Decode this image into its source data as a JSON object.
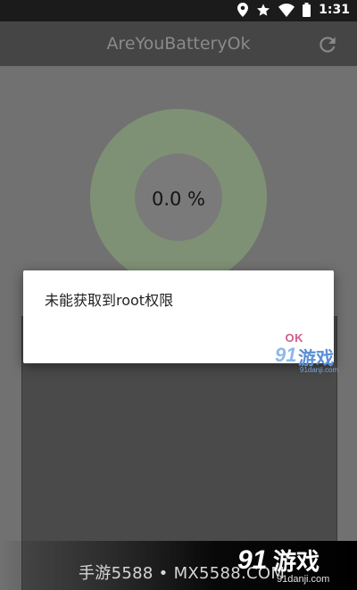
{
  "status_bar": {
    "time": "1:31",
    "icons": [
      "location-icon",
      "star-icon",
      "wifi-icon",
      "battery-icon"
    ]
  },
  "toolbar": {
    "title": "AreYouBatteryOk",
    "refresh_icon": "refresh-icon"
  },
  "battery": {
    "percent_text": "0.0 %",
    "ring_color": "#7f9175"
  },
  "dialog": {
    "message": "未能获取到root权限",
    "ok_label": "OK",
    "accent": "#cf5f8a"
  },
  "watermark_small": {
    "logo": "91",
    "text": "游戏",
    "url": "91danji.com"
  },
  "footer": {
    "text": "手游5588 • MX5588.COM"
  },
  "watermark_big": {
    "logo": "91",
    "text": "游戏",
    "url": "91danji.com"
  }
}
